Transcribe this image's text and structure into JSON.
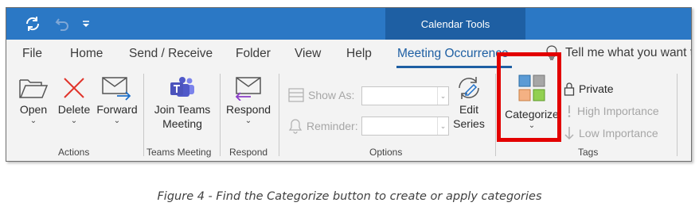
{
  "title_bar": {
    "contextual_tab": "Calendar Tools"
  },
  "tabs": [
    {
      "label": "File"
    },
    {
      "label": "Home"
    },
    {
      "label": "Send / Receive"
    },
    {
      "label": "Folder"
    },
    {
      "label": "View"
    },
    {
      "label": "Help"
    },
    {
      "label": "Meeting Occurrence"
    }
  ],
  "active_tab": "Meeting Occurrence",
  "tell_me": "Tell me what you want to do",
  "ribbon": {
    "actions": {
      "open": "Open",
      "delete": "Delete",
      "forward": "Forward",
      "group": "Actions"
    },
    "teams": {
      "join_line1": "Join Teams",
      "join_line2": "Meeting",
      "group": "Teams Meeting"
    },
    "respond": {
      "respond": "Respond",
      "group": "Respond"
    },
    "options": {
      "show_as": "Show As:",
      "reminder": "Reminder:",
      "edit_line1": "Edit",
      "edit_line2": "Series",
      "group": "Options"
    },
    "tags": {
      "categorize": "Categorize",
      "private": "Private",
      "high": "High Importance",
      "low": "Low Importance",
      "group": "Tags"
    }
  },
  "caption": "Figure 4 - Find the Categorize button to create or apply categories",
  "colors": {
    "title_bar": "#2b78c5",
    "contextual": "#1e5fa3",
    "highlight": "#e30000",
    "active_tab": "#1e5fa3"
  }
}
